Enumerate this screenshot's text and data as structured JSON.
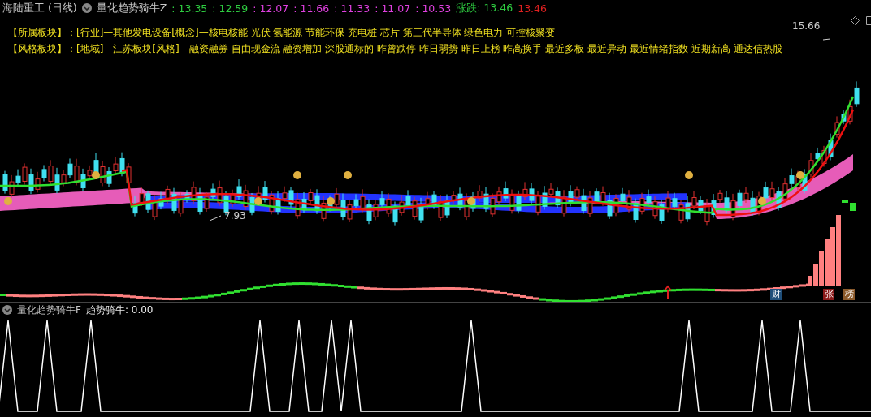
{
  "quote": {
    "stock": "海陆重工 (日线)",
    "indicator": "量化趋势骑牛Z",
    "values": [
      {
        "text": ": 13.35",
        "color": "#2ecc40"
      },
      {
        "text": ": 12.59",
        "color": "#2ecc40"
      },
      {
        "text": ": 12.07",
        "color": "#e040e0"
      },
      {
        "text": ": 11.66",
        "color": "#e040e0"
      },
      {
        "text": ": 11.33",
        "color": "#e040e0"
      },
      {
        "text": ": 11.07",
        "color": "#e040e0"
      },
      {
        "text": ": 10.53",
        "color": "#e040e0"
      },
      {
        "text": "涨跌: 13.46",
        "color": "#2ecc40"
      },
      {
        "text": "13.46",
        "color": "#e02020"
      }
    ]
  },
  "sectors": [
    {
      "text": "【所属板块】：[行业]—其他发电设备[概念]—核电核能 光伏 氢能源 节能环保 充电桩 芯片 第三代半导体 绿色电力 可控核聚变"
    },
    {
      "text": "【风格板块】：[地域]—江苏板块[风格]—融资融券 自由现金流 融资增加 深股通标的 昨曾跌停 昨日弱势 昨日上榜 昨高换手 最近多板 最近异动 最近情绪指数 近期新高 通达信热股"
    }
  ],
  "price_labels": {
    "high": "15.66",
    "low": "7.93"
  },
  "badges": [
    {
      "text": "财",
      "color": "#1f4e79"
    },
    {
      "text": "张",
      "color": "#8b1a1a"
    },
    {
      "text": "榜",
      "color": "#8b5a2b"
    }
  ],
  "lower_panel": {
    "indicator": "量化趋势骑牛F",
    "reading": "趋势骑牛: 0.00"
  }
}
